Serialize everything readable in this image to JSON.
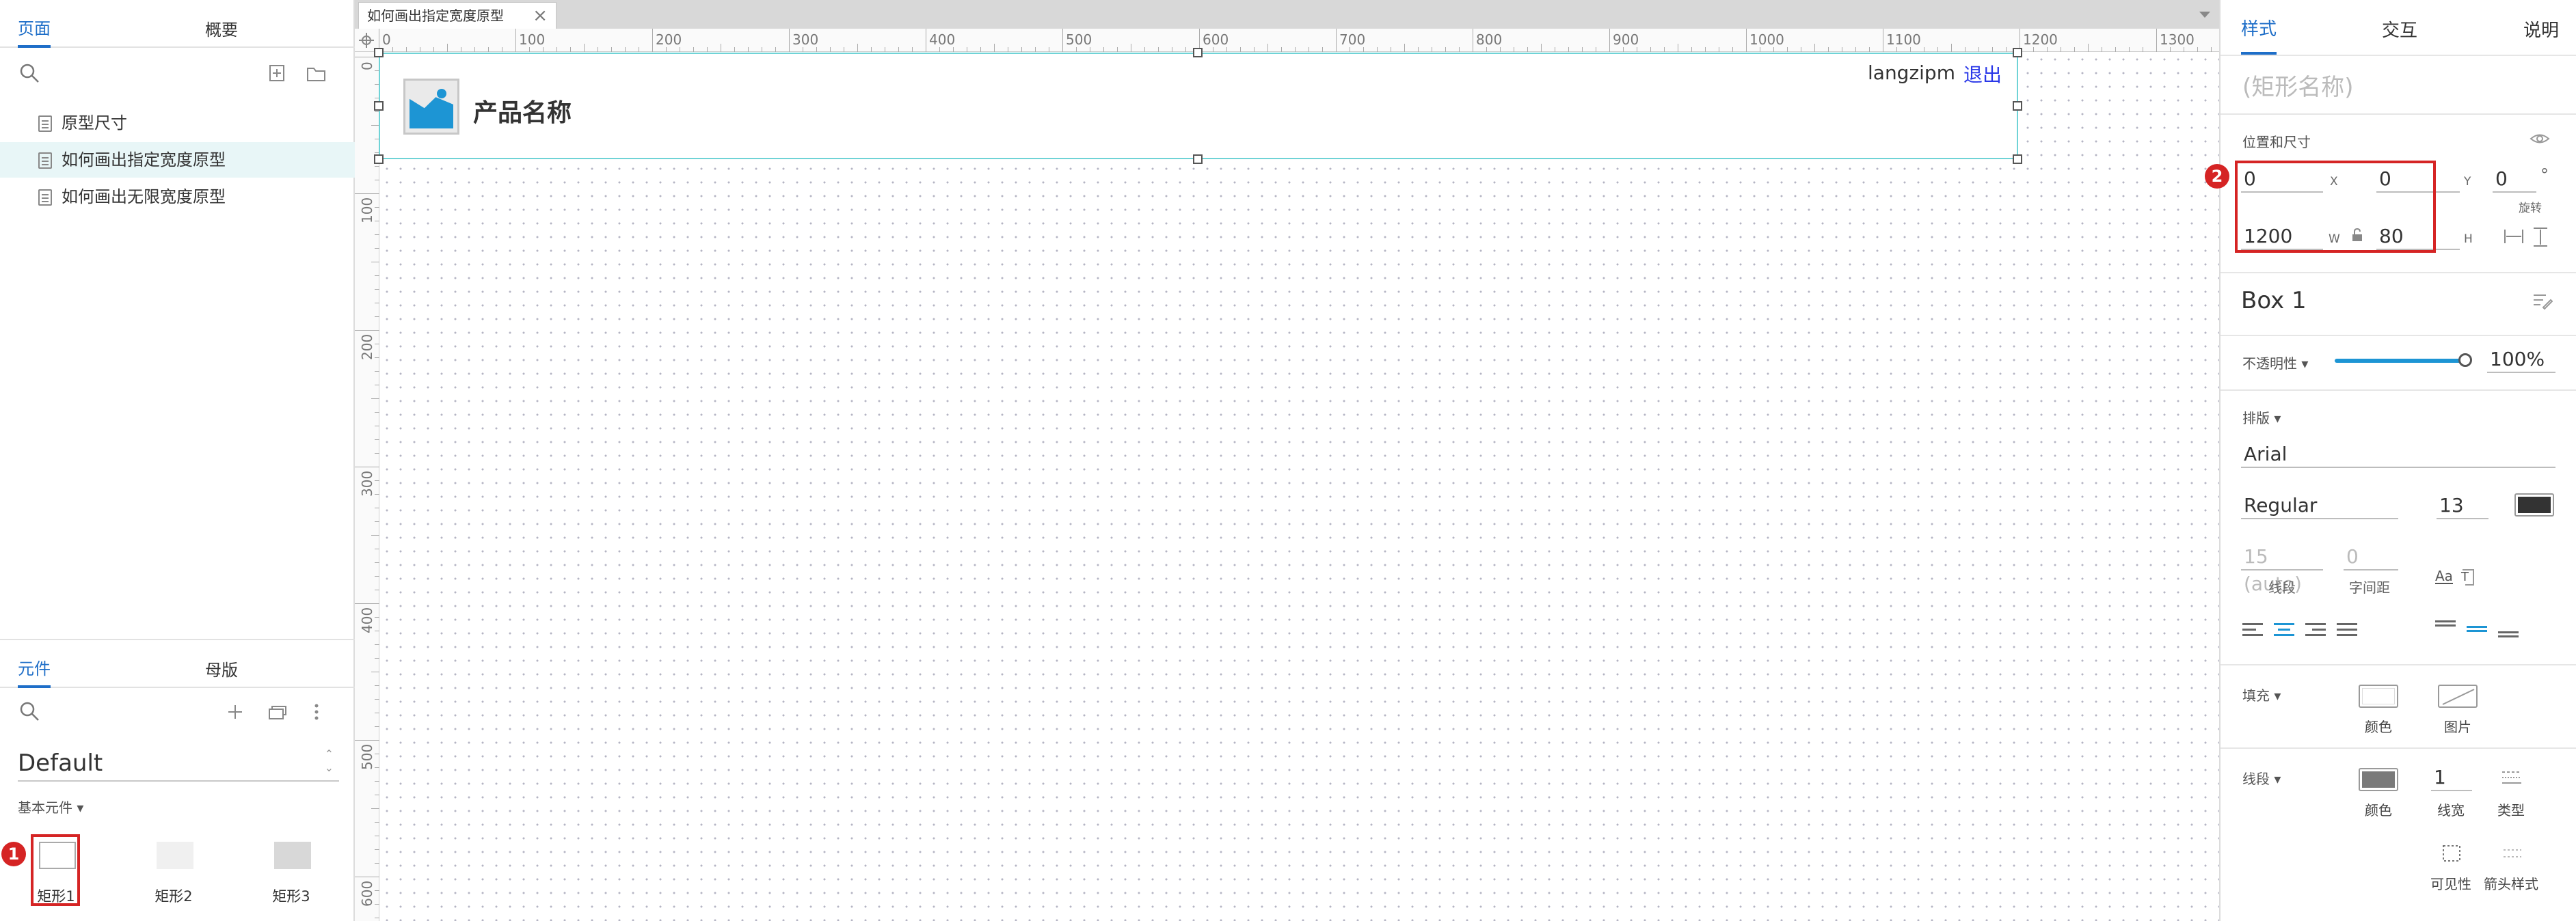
{
  "left_panel": {
    "top_tabs": [
      {
        "label": "页面",
        "active": true
      },
      {
        "label": "概要",
        "active": false
      }
    ],
    "pages": [
      {
        "label": "原型尺寸",
        "selected": false
      },
      {
        "label": "如何画出指定宽度原型",
        "selected": true
      },
      {
        "label": "如何画出无限宽度原型",
        "selected": false
      }
    ],
    "bottom_tabs": [
      {
        "label": "元件",
        "active": true
      },
      {
        "label": "母版",
        "active": false
      }
    ],
    "library": {
      "name": "Default",
      "group": "基本元件 ▾"
    },
    "widgets": [
      {
        "label": "矩形1",
        "fill": "#ffffff"
      },
      {
        "label": "矩形2",
        "fill": "#f0f0f0"
      },
      {
        "label": "矩形3",
        "fill": "#d8d8d8"
      }
    ],
    "badge": "1"
  },
  "canvas": {
    "tab_title": "如何画出指定宽度原型",
    "ruler_top": [
      "0",
      "100",
      "200",
      "300",
      "400",
      "500",
      "600",
      "700",
      "800",
      "900",
      "1000",
      "1100",
      "1200",
      "1300"
    ],
    "ruler_left": [
      "0",
      "100",
      "200",
      "300",
      "400",
      "500",
      "600"
    ],
    "header": {
      "product_name": "产品名称",
      "username": "langzipm",
      "logout": "退出"
    }
  },
  "right_panel": {
    "tabs": [
      {
        "label": "样式",
        "active": true
      },
      {
        "label": "交互",
        "active": false
      },
      {
        "label": "说明",
        "active": false
      }
    ],
    "shape_name_placeholder": "(矩形名称)",
    "position_size": {
      "title": "位置和尺寸",
      "x": "0",
      "x_label": "X",
      "y": "0",
      "y_label": "Y",
      "rotation": "0",
      "rotation_unit": "°",
      "rotation_label": "旋转",
      "w": "1200",
      "w_label": "W",
      "h": "80",
      "h_label": "H"
    },
    "badge": "2",
    "style_name": "Box 1",
    "opacity": {
      "label": "不透明性 ▾",
      "value": "100%"
    },
    "typography": {
      "title": "排版 ▾",
      "font": "Arial",
      "weight": "Regular",
      "size": "13",
      "color": "#333333",
      "line_spacing": "15 (auto)",
      "line_spacing_label": "线段",
      "char_spacing": "0",
      "char_spacing_label": "字间距"
    },
    "fill": {
      "title": "填充 ▾",
      "color_label": "颜色",
      "image_label": "图片"
    },
    "border": {
      "title": "线段 ▾",
      "color_label": "颜色",
      "color": "#7a7a7a",
      "width": "1",
      "width_label": "线宽",
      "type_label": "类型",
      "visibility_label": "可见性",
      "arrow_label": "箭头样式"
    }
  }
}
